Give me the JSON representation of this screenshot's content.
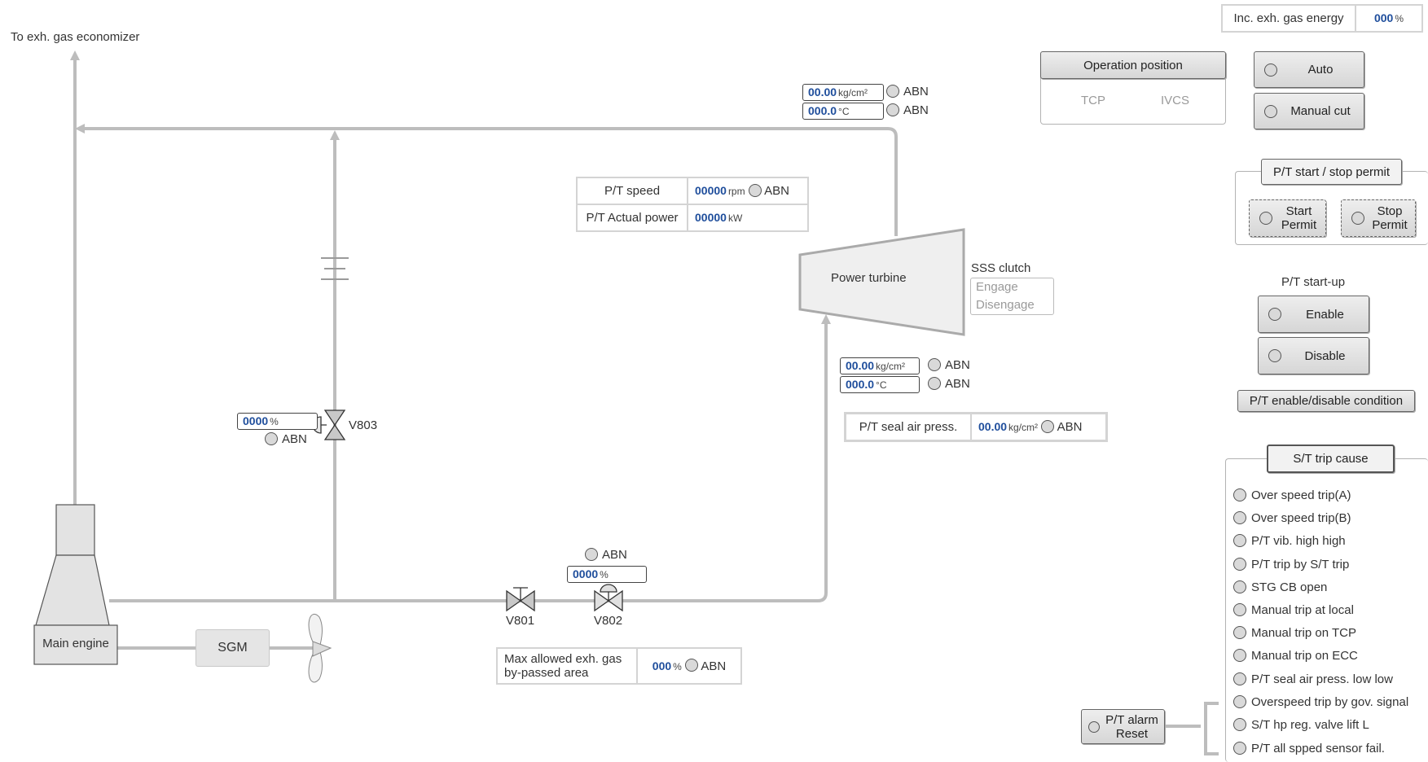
{
  "labels": {
    "to_economizer": "To exh. gas economizer",
    "main_engine": "Main engine",
    "sgm": "SGM",
    "power_turbine": "Power turbine",
    "sss_clutch": "SSS clutch",
    "engage": "Engage",
    "disengage": "Disengage",
    "v801": "V801",
    "v802": "V802",
    "v803": "V803",
    "abn": "ABN"
  },
  "top_inlet": {
    "pressure": {
      "value": "00.00",
      "unit": "kg/cm²"
    },
    "temperature": {
      "value": "000.0",
      "unit": "°C"
    }
  },
  "turbine_inlet": {
    "pressure": {
      "value": "00.00",
      "unit": "kg/cm²"
    },
    "temperature": {
      "value": "000.0",
      "unit": "°C"
    }
  },
  "v803_position": {
    "value": "0000",
    "unit": "%"
  },
  "v802_position": {
    "value": "0000",
    "unit": "%"
  },
  "pt_table": {
    "speed_label": "P/T speed",
    "speed_value": "00000",
    "speed_unit": "rpm",
    "power_label": "P/T Actual power",
    "power_value": "00000",
    "power_unit": "kW"
  },
  "seal_air": {
    "label": "P/T seal air press.",
    "value": "00.00",
    "unit": "kg/cm²"
  },
  "bypass": {
    "label_line1": "Max allowed exh. gas",
    "label_line2": "by-passed area",
    "value": "000",
    "unit": "%"
  },
  "inc_energy": {
    "label": "Inc. exh. gas energy",
    "value": "000",
    "unit": "%"
  },
  "operation": {
    "title": "Operation position",
    "tcp": "TCP",
    "ivcs": "IVCS"
  },
  "mode": {
    "auto": "Auto",
    "manual_cut": "Manual cut"
  },
  "permit": {
    "title": "P/T start / stop permit",
    "start_l1": "Start",
    "start_l2": "Permit",
    "stop_l1": "Stop",
    "stop_l2": "Permit"
  },
  "startup": {
    "title": "P/T start-up",
    "enable": "Enable",
    "disable": "Disable",
    "condition": "P/T enable/disable condition"
  },
  "trip": {
    "title": "S/T trip cause",
    "items": [
      "Over speed trip(A)",
      "Over speed trip(B)",
      "P/T vib. high high",
      "P/T trip by S/T trip",
      "STG CB open",
      "Manual trip at local",
      "Manual trip on TCP",
      "Manual trip on ECC",
      "P/T seal air press. low low",
      "Overspeed trip by gov. signal",
      "S/T hp reg. valve lift L",
      "P/T all spped sensor fail."
    ]
  },
  "alarm_reset": {
    "line1": "P/T alarm",
    "line2": "Reset"
  },
  "colors": {
    "value_text": "#1f4e9c",
    "pipe": "#bdbdbd",
    "lamp": "#d9d9d9"
  }
}
